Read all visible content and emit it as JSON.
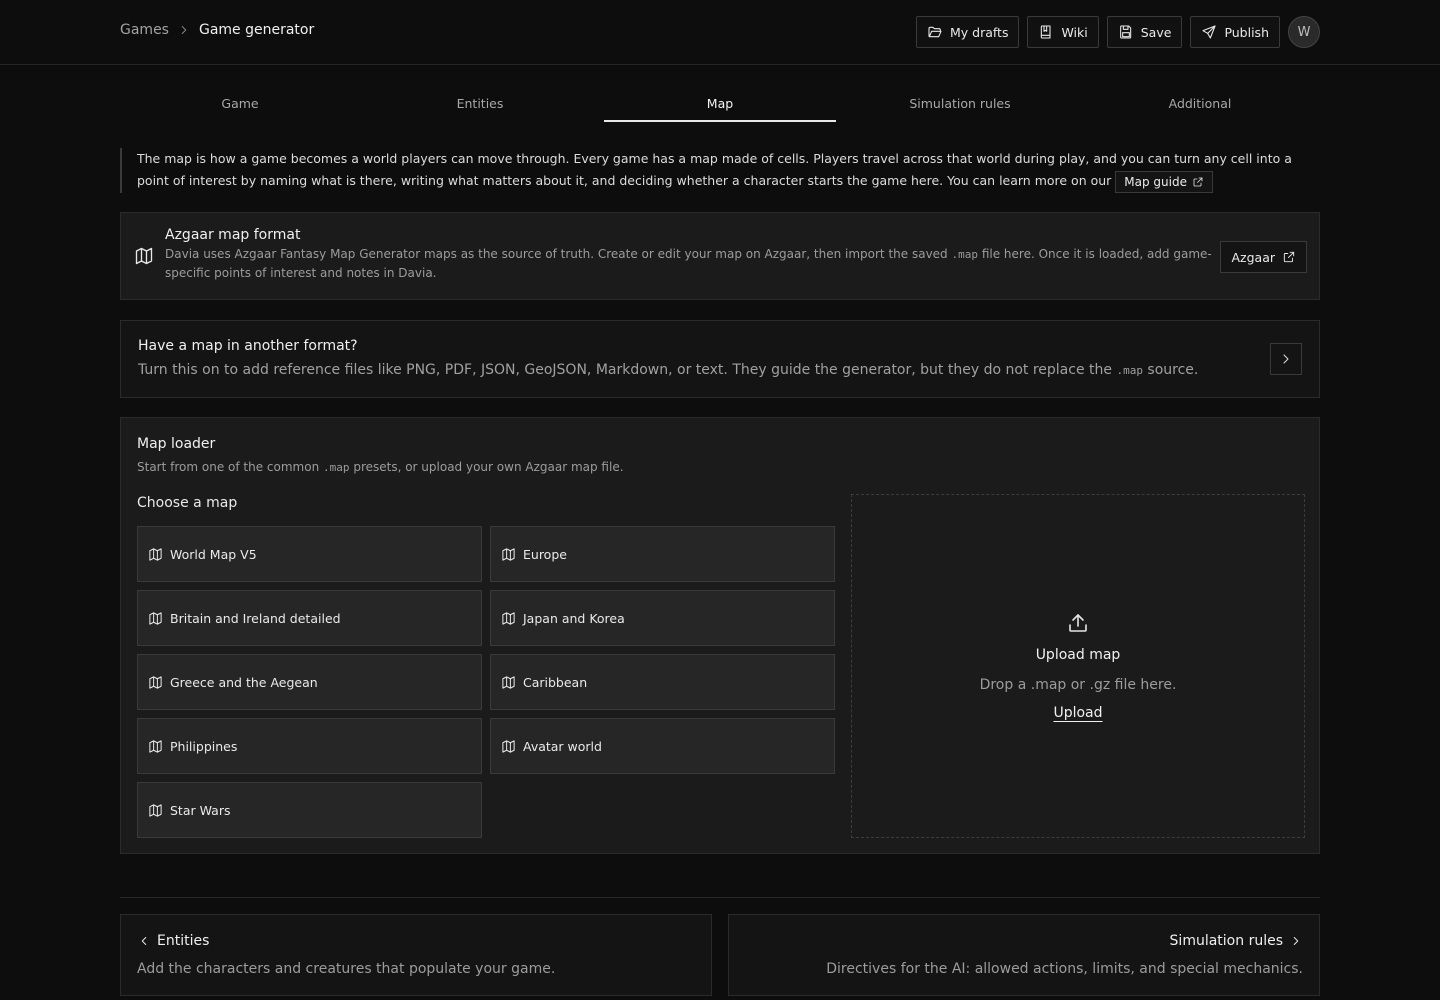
{
  "breadcrumb": {
    "parent": "Games",
    "current": "Game generator"
  },
  "header": {
    "drafts_label": "My drafts",
    "wiki_label": "Wiki",
    "save_label": "Save",
    "publish_label": "Publish",
    "avatar_initial": "W"
  },
  "tabs": [
    {
      "label": "Game",
      "active": false
    },
    {
      "label": "Entities",
      "active": false
    },
    {
      "label": "Map",
      "active": true
    },
    {
      "label": "Simulation rules",
      "active": false
    },
    {
      "label": "Additional",
      "active": false
    }
  ],
  "intro": {
    "text": "The map is how a game becomes a world players can move through. Every game has a map made of cells. Players travel across that world during play, and you can turn any cell into a point of interest by naming what is there, writing what matters about it, and deciding whether a character starts the game here. You can learn more on our",
    "link_label": "Map guide"
  },
  "azgaar": {
    "title": "Azgaar map format",
    "desc_before": "Davia uses Azgaar Fantasy Map Generator maps as the source of truth. Create or edit your map on Azgaar, then import the saved",
    "desc_code": ".map",
    "desc_after": "file here. Once it is loaded, add game-specific points of interest and notes in Davia.",
    "button_label": "Azgaar"
  },
  "other_format": {
    "title": "Have a map in another format?",
    "desc_before": "Turn this on to add reference files like PNG, PDF, JSON, GeoJSON, Markdown, or text. They guide the generator, but they do not replace the",
    "desc_code": ".map",
    "desc_after": "source."
  },
  "loader": {
    "title": "Map loader",
    "desc_before": "Start from one of the common",
    "desc_code": ".map",
    "desc_after": "presets, or upload your own Azgaar map file.",
    "choose_label": "Choose a map",
    "presets": [
      "World Map V5",
      "Europe",
      "Britain and Ireland detailed",
      "Japan and Korea",
      "Greece and the Aegean",
      "Caribbean",
      "Philippines",
      "Avatar world",
      "Star Wars"
    ],
    "upload": {
      "title": "Upload map",
      "desc": "Drop a .map or .gz file here.",
      "link": "Upload"
    }
  },
  "nav": {
    "prev": {
      "title": "Entities",
      "desc": "Add the characters and creatures that populate your game."
    },
    "next": {
      "title": "Simulation rules",
      "desc": "Directives for the AI: allowed actions, limits, and special mechanics."
    }
  }
}
